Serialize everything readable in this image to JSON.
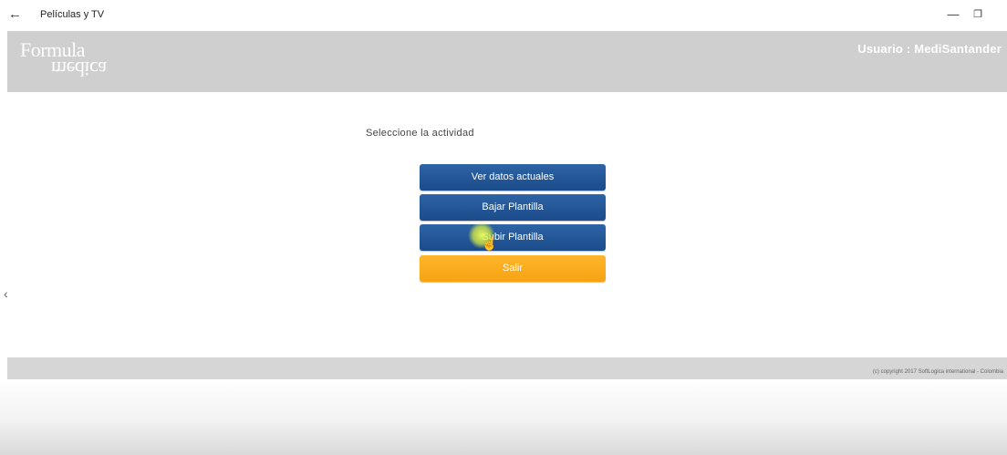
{
  "window": {
    "title": "Películas y TV",
    "back_glyph": "←",
    "minimize_glyph": "—",
    "restore_glyph": "❐"
  },
  "header": {
    "logo_line1": "Formula",
    "logo_line2": "medica",
    "user_text": "Usuario : MediSantander"
  },
  "main": {
    "prompt": "Seleccione la actividad",
    "buttons": [
      {
        "label": "Ver datos actuales"
      },
      {
        "label": "Bajar Plantilla"
      },
      {
        "label": "Subir Plantilla"
      },
      {
        "label": "Salir"
      }
    ]
  },
  "footer": {
    "copyright": "(c) copyright 2017 SoftLogica international - Colombia"
  },
  "colors": {
    "header_bg": "#cfcfcf",
    "button_blue": "#1b4b8a",
    "button_orange": "#f6a313",
    "footer_bg": "#d6d6d6"
  },
  "icons": {
    "back": "back-arrow-icon",
    "minimize": "minimize-icon",
    "restore": "restore-icon",
    "cursor": "hand-cursor-icon"
  }
}
